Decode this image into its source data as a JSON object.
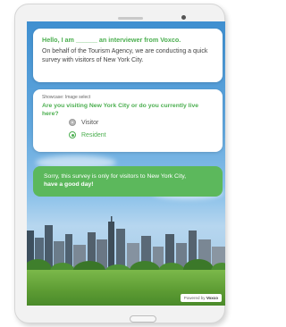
{
  "survey": {
    "intro_title": "Hello, I am ______ an interviewer from Voxco.",
    "intro_body": "On behalf of the Tourism Agency, we are conducting a quick survey with visitors of New York City.",
    "question_showcase": "Showcase: Image select",
    "question_text": "Are you visiting New York City or do you currently live here?",
    "options": [
      {
        "label": "Visitor",
        "selected": false
      },
      {
        "label": "Resident",
        "selected": true
      }
    ],
    "closing_line1": "Sorry, this survey is only for visitors to New York City,",
    "closing_line2": "have a good day!",
    "powered_prefix": "Powered by",
    "powered_brand": "Voxco"
  },
  "colors": {
    "accent": "#4caf50",
    "closing_bg": "#5cb85c",
    "sky": "#3f8fd0"
  }
}
